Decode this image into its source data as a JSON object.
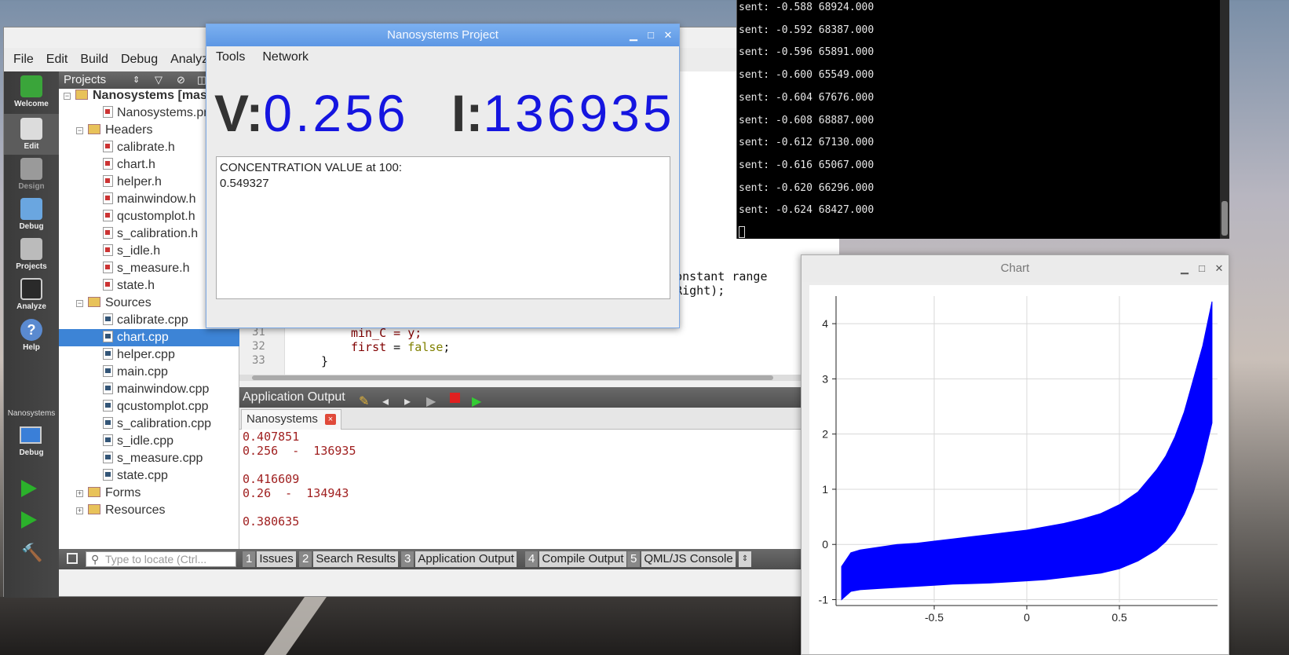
{
  "qtcreator": {
    "menu": [
      "File",
      "Edit",
      "Build",
      "Debug",
      "Analyze"
    ],
    "modes": [
      {
        "label": "Welcome",
        "icon": "qt-logo-icon"
      },
      {
        "label": "Edit",
        "icon": "edit-document-icon"
      },
      {
        "label": "Design",
        "icon": "design-pencil-icon"
      },
      {
        "label": "Debug",
        "icon": "debug-bug-icon"
      },
      {
        "label": "Projects",
        "icon": "projects-wrench-icon"
      },
      {
        "label": "Analyze",
        "icon": "analyze-monitor-icon"
      },
      {
        "label": "Help",
        "icon": "help-icon"
      }
    ],
    "kit": {
      "project": "Nanosystems",
      "mode": "Debug"
    },
    "projects_header": "Projects",
    "tree": [
      {
        "text": "Nanosystems [master",
        "kind": "root",
        "indent": 0
      },
      {
        "text": "Nanosystems.pro",
        "kind": "pro",
        "indent": 2
      },
      {
        "text": "Headers",
        "kind": "folder",
        "indent": 1
      },
      {
        "text": "calibrate.h",
        "kind": "h",
        "indent": 2
      },
      {
        "text": "chart.h",
        "kind": "h",
        "indent": 2
      },
      {
        "text": "helper.h",
        "kind": "h",
        "indent": 2
      },
      {
        "text": "mainwindow.h",
        "kind": "h",
        "indent": 2
      },
      {
        "text": "qcustomplot.h",
        "kind": "h",
        "indent": 2
      },
      {
        "text": "s_calibration.h",
        "kind": "h",
        "indent": 2
      },
      {
        "text": "s_idle.h",
        "kind": "h",
        "indent": 2
      },
      {
        "text": "s_measure.h",
        "kind": "h",
        "indent": 2
      },
      {
        "text": "state.h",
        "kind": "h",
        "indent": 2
      },
      {
        "text": "Sources",
        "kind": "folder",
        "indent": 1
      },
      {
        "text": "calibrate.cpp",
        "kind": "c",
        "indent": 2
      },
      {
        "text": "chart.cpp",
        "kind": "c",
        "indent": 2,
        "selected": true
      },
      {
        "text": "helper.cpp",
        "kind": "c",
        "indent": 2
      },
      {
        "text": "main.cpp",
        "kind": "c",
        "indent": 2
      },
      {
        "text": "mainwindow.cpp",
        "kind": "c",
        "indent": 2
      },
      {
        "text": "qcustomplot.cpp",
        "kind": "c",
        "indent": 2
      },
      {
        "text": "s_calibration.cpp",
        "kind": "c",
        "indent": 2
      },
      {
        "text": "s_idle.cpp",
        "kind": "c",
        "indent": 2
      },
      {
        "text": "s_measure.cpp",
        "kind": "c",
        "indent": 2
      },
      {
        "text": "state.cpp",
        "kind": "c",
        "indent": 2
      },
      {
        "text": "Forms",
        "kind": "folder",
        "indent": 1
      },
      {
        "text": "Resources",
        "kind": "folder",
        "indent": 1
      }
    ],
    "editor": {
      "visible_fragments": [
        "a constant range",
        "ignRight);"
      ],
      "lines": [
        {
          "num": "31",
          "text": "min_C = y;"
        },
        {
          "num": "32",
          "text_var": "first",
          "text_eq": " = ",
          "text_kw": "false",
          "text_end": ";"
        },
        {
          "num": "33",
          "text": "}"
        }
      ]
    },
    "output": {
      "title": "Application Output",
      "tab": "Nanosystems",
      "lines": [
        "0.407851",
        "0.256  -  136935",
        "",
        "0.416609",
        "0.26  -  134943",
        "",
        "0.380635"
      ]
    },
    "status": {
      "locate_placeholder": "Type to locate (Ctrl...",
      "tabs": [
        {
          "n": "1",
          "label": "Issues"
        },
        {
          "n": "2",
          "label": "Search Results"
        },
        {
          "n": "3",
          "label": "Application Output"
        },
        {
          "n": "4",
          "label": "Compile Output"
        },
        {
          "n": "5",
          "label": "QML/JS Console"
        }
      ]
    }
  },
  "nano": {
    "title": "Nanosystems Project",
    "menu": [
      "Tools",
      "Network"
    ],
    "v_label": "V:",
    "v_value": "0.256",
    "i_label": "I:",
    "i_value": "136935",
    "box_line1": "CONCENTRATION VALUE at 100:",
    "box_line2": "0.549327"
  },
  "terminal": {
    "lines": [
      "sent: -0.588 68924.000",
      "sent: -0.592 68387.000",
      "sent: -0.596 65891.000",
      "sent: -0.600 65549.000",
      "sent: -0.604 67676.000",
      "sent: -0.608 68887.000",
      "sent: -0.612 67130.000",
      "sent: -0.616 65067.000",
      "sent: -0.620 66296.000",
      "sent: -0.624 68427.000"
    ]
  },
  "chart_window": {
    "title": "Chart"
  },
  "chart_data": {
    "type": "area",
    "title": "",
    "xlabel": "",
    "ylabel": "",
    "xlim": [
      -1.03,
      1.03
    ],
    "ylim": [
      -1.05,
      4.5
    ],
    "xticks": [
      "-0.5",
      "0",
      "0.5"
    ],
    "xtick_values": [
      -0.5,
      0,
      0.5
    ],
    "yticks": [
      "-1",
      "0",
      "1",
      "2",
      "3",
      "4"
    ],
    "ytick_values": [
      -1,
      0,
      1,
      2,
      3,
      4
    ],
    "grid": true,
    "color": "#0000ff",
    "series": [
      {
        "x": [
          -1.0,
          -0.95,
          -0.9,
          -0.8,
          -0.7,
          -0.6,
          -0.5,
          -0.4,
          -0.3,
          -0.2,
          -0.1,
          0.0,
          0.1,
          0.2,
          0.3,
          0.4,
          0.5,
          0.6,
          0.7,
          0.75,
          0.8,
          0.85,
          0.9,
          0.95,
          1.0
        ],
        "upper": [
          -0.4,
          -0.15,
          -0.1,
          -0.05,
          0.0,
          0.02,
          0.06,
          0.1,
          0.14,
          0.18,
          0.22,
          0.26,
          0.32,
          0.38,
          0.46,
          0.56,
          0.72,
          0.95,
          1.35,
          1.6,
          1.95,
          2.4,
          3.0,
          3.6,
          4.4
        ],
        "lower": [
          -1.0,
          -0.85,
          -0.82,
          -0.8,
          -0.78,
          -0.76,
          -0.74,
          -0.72,
          -0.71,
          -0.7,
          -0.68,
          -0.66,
          -0.64,
          -0.6,
          -0.56,
          -0.52,
          -0.44,
          -0.3,
          -0.1,
          0.05,
          0.25,
          0.55,
          0.95,
          1.5,
          2.2
        ]
      }
    ]
  }
}
